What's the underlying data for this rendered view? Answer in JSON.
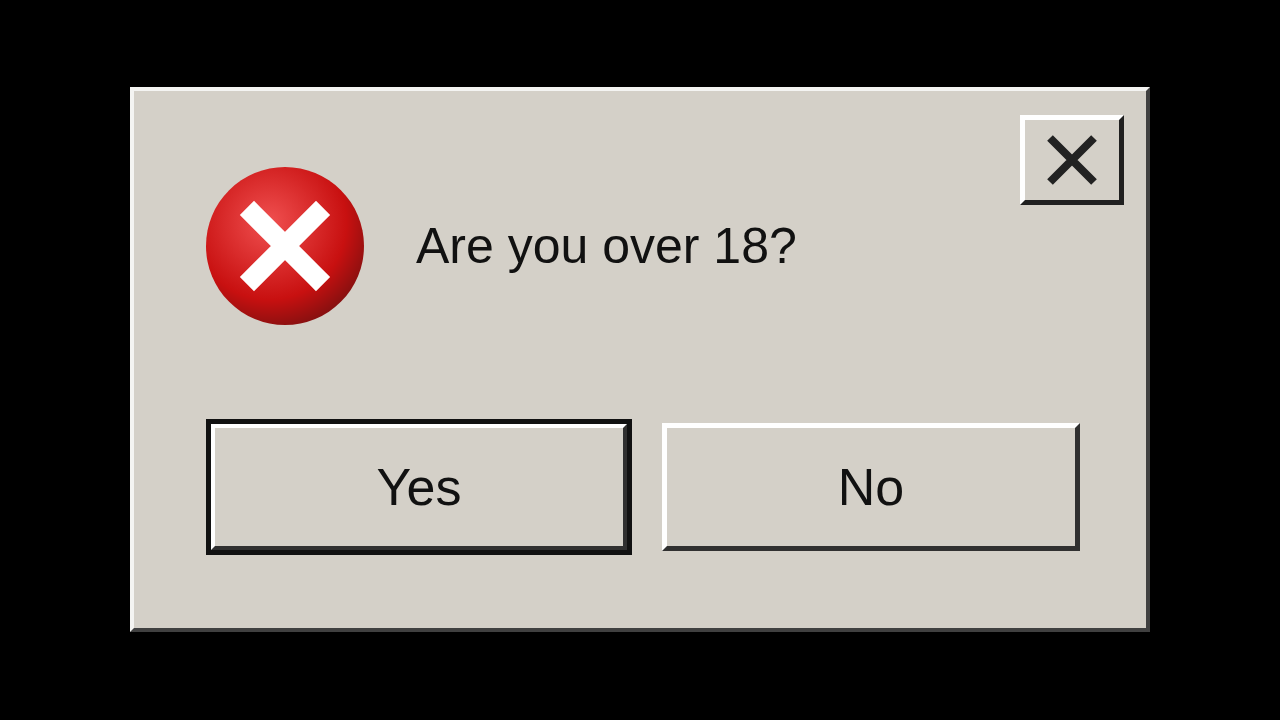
{
  "dialog": {
    "message": "Are you over 18?",
    "buttons": [
      {
        "label": "Yes",
        "default": true
      },
      {
        "label": "No",
        "default": false
      }
    ]
  }
}
